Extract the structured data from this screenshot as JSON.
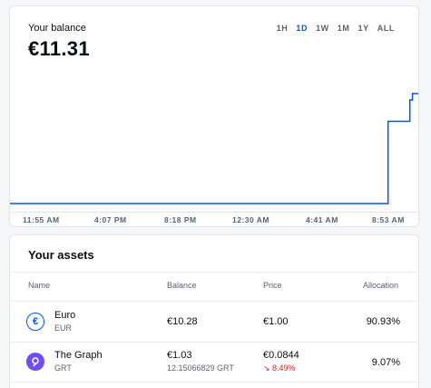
{
  "balance": {
    "label": "Your balance",
    "value": "€11.31",
    "ranges": [
      "1H",
      "1D",
      "1W",
      "1M",
      "1Y",
      "ALL"
    ],
    "active_range": "1D",
    "accent_color": "#0052ff"
  },
  "time_axis": [
    "11:55 AM",
    "4:07 PM",
    "8:18 PM",
    "12:30 AM",
    "4:41 AM",
    "8:53 AM"
  ],
  "assets": {
    "title": "Your assets",
    "columns": {
      "name": "Name",
      "balance": "Balance",
      "price": "Price",
      "allocation": "Allocation"
    },
    "rows": [
      {
        "name": "Euro",
        "ticker": "EUR",
        "icon": "euro-icon",
        "balance": "€10.28",
        "balance_sub": "",
        "price": "€1.00",
        "change": "",
        "allocation": "90.93%"
      },
      {
        "name": "The Graph",
        "ticker": "GRT",
        "icon": "the-graph-icon",
        "balance": "€1.03",
        "balance_sub": "12.15066829 GRT",
        "price": "€0.0844",
        "change": "↘ 8.49%",
        "allocation": "9.07%"
      }
    ]
  },
  "chart_data": {
    "type": "line",
    "x_ticks": [
      "11:55 AM",
      "4:07 PM",
      "8:18 PM",
      "12:30 AM",
      "4:41 AM",
      "8:53 AM"
    ],
    "x_hours": [
      0,
      28,
      29.5,
      29.8,
      31.2,
      31.4,
      32
    ],
    "values": [
      10.28,
      10.28,
      11.05,
      11.05,
      11.25,
      11.31,
      11.05
    ],
    "color": "#0052ff",
    "grid": false
  }
}
